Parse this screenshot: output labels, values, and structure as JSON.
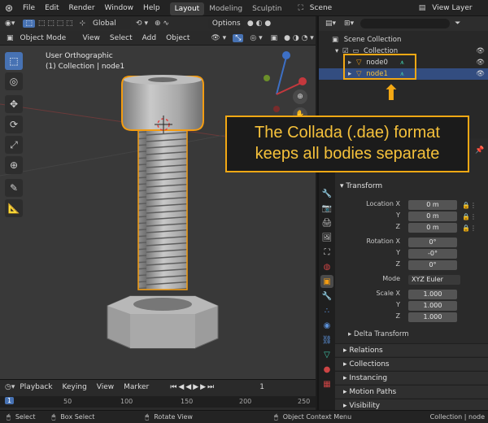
{
  "topbar": {
    "menus": [
      "File",
      "Edit",
      "Render",
      "Window",
      "Help"
    ],
    "workspaces": [
      "Layout",
      "Modeling",
      "Sculptin"
    ],
    "scene": "Scene",
    "view_layer": "View Layer"
  },
  "tool_options": {
    "orientation": "Global",
    "options": "Options"
  },
  "viewport_header": {
    "mode": "Object Mode",
    "menus": [
      "View",
      "Select",
      "Add",
      "Object"
    ]
  },
  "viewport": {
    "view_name": "User Orthographic",
    "collection_info": "(1) Collection | node1"
  },
  "outliner": {
    "scene_collection": "Scene Collection",
    "collection": "Collection",
    "items": [
      "node0",
      "node1"
    ]
  },
  "callout": {
    "line1": "The Collada (.dae) format",
    "line2": "keeps all bodies separate"
  },
  "properties": {
    "transform_title": "Transform",
    "location_label": "Location X",
    "rotation_label": "Rotation X",
    "scale_label": "Scale X",
    "y_label": "Y",
    "z_label": "Z",
    "mode_label": "Mode",
    "loc": [
      "0 m",
      "0 m",
      "0 m"
    ],
    "rot": [
      "0°",
      "-0°",
      "0°"
    ],
    "mode": "XYZ Euler",
    "scale": [
      "1.000",
      "1.000",
      "1.000"
    ],
    "delta": "Delta Transform",
    "sections": [
      "Relations",
      "Collections",
      "Instancing",
      "Motion Paths",
      "Visibility"
    ]
  },
  "timeline": {
    "menus": [
      "Playback",
      "Keying",
      "View",
      "Marker"
    ],
    "frame": "1",
    "ticks": [
      "1",
      "50",
      "100",
      "150",
      "200",
      "250"
    ]
  },
  "status": {
    "select": "Select",
    "box_select": "Box Select",
    "rotate_view": "Rotate View",
    "context_menu": "Object Context Menu",
    "right_info": "Collection | node"
  },
  "colors": {
    "accent": "#4772b3",
    "callout_border": "#f3a814",
    "callout_text": "#f5c13b",
    "selection_outline": "#f39c12"
  }
}
